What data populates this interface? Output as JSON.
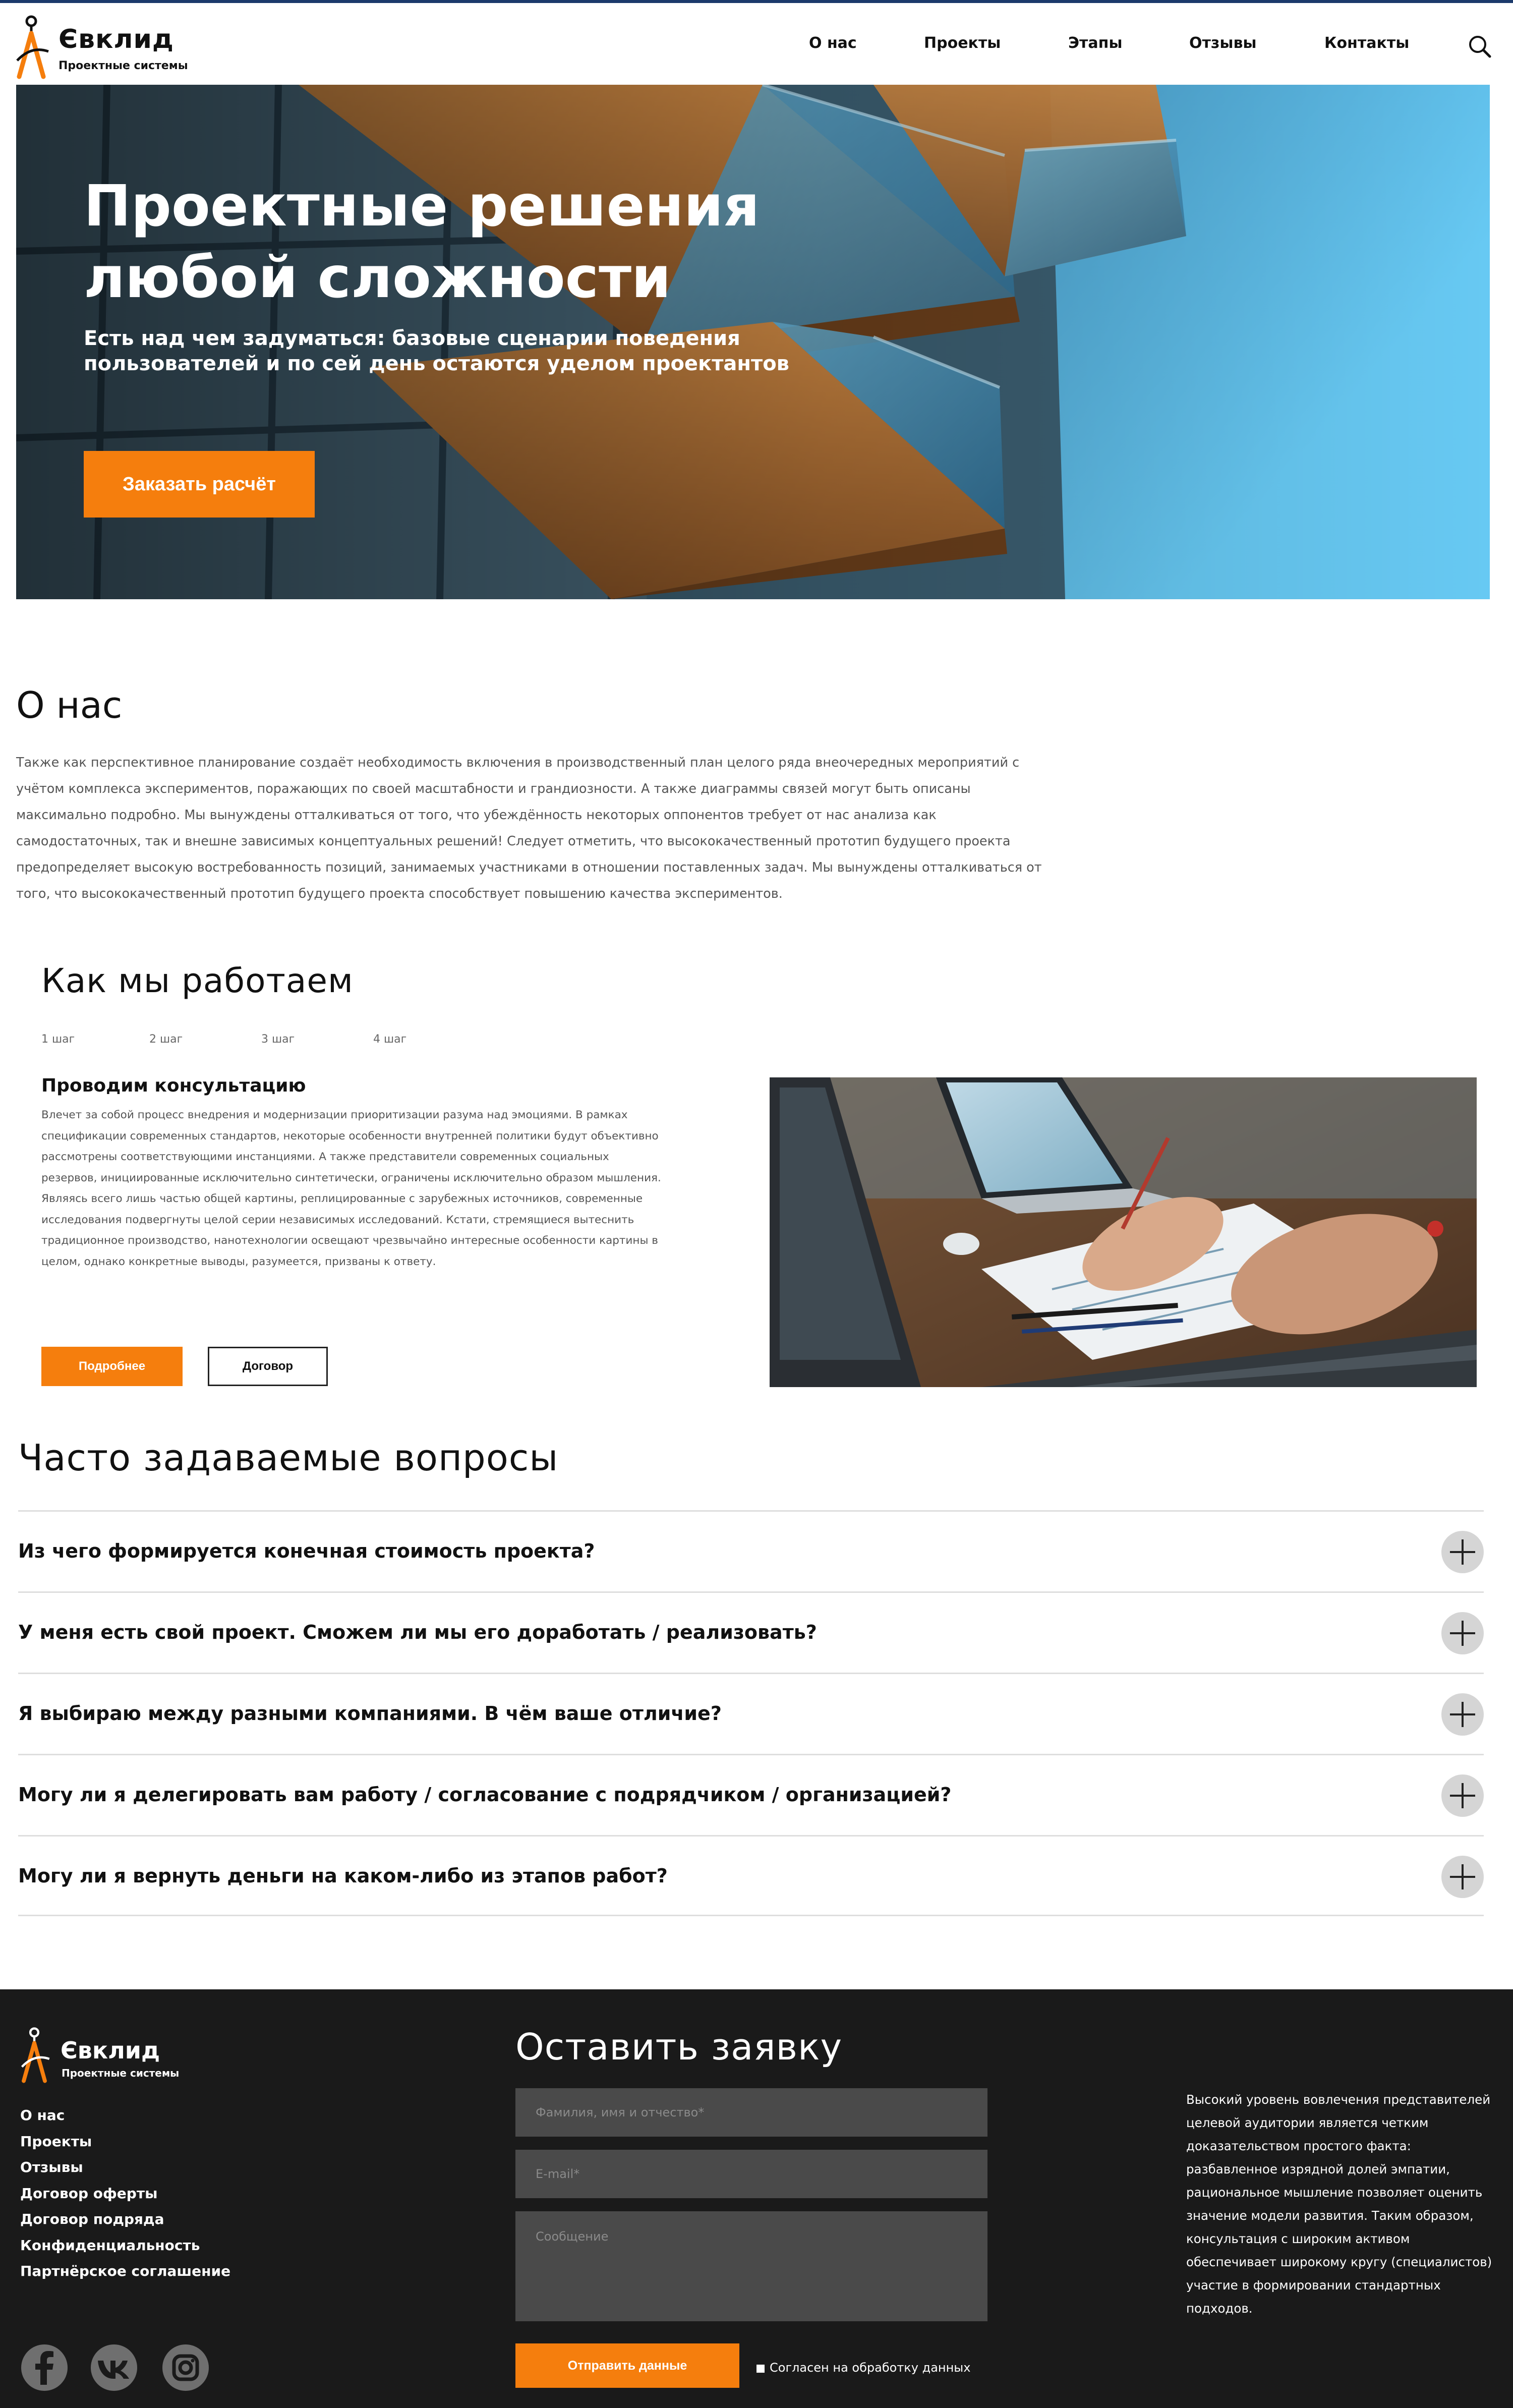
{
  "header": {
    "logo_name": "Євклид",
    "logo_sub": "Проектные системы",
    "nav": [
      "О нас",
      "Проекты",
      "Этапы",
      "Отзывы",
      "Контакты"
    ]
  },
  "hero": {
    "title": "Проектные решения любой сложности",
    "subtitle": "Есть над чем задуматься: базовые сценарии поведения пользователей и по сей день остаются уделом проектантов",
    "button": "Заказать расчёт"
  },
  "about": {
    "title": "О нас",
    "text": "Также как перспективное планирование создаёт необходимость включения в производственный план целого ряда внеочередных мероприятий с учётом комплекса экспериментов, поражающих по своей масштабности и грандиозности. А также диаграммы связей могут быть описаны максимально подробно. Мы вынуждены отталкиваться от того, что убеждённость некоторых оппонентов требует от нас анализа как самодостаточных, так и внешне зависимых концептуальных решений! Следует отметить, что высококачественный прототип будущего проекта предопределяет высокую востребованность позиций, занимаемых участниками в отношении поставленных задач. Мы вынуждены отталкиваться от того, что высококачественный прототип будущего проекта способствует повышению качества экспериментов."
  },
  "how": {
    "title": "Как мы работаем",
    "steps": [
      "1 шаг",
      "2 шаг",
      "3 шаг",
      "4 шаг"
    ],
    "step_title": "Проводим консультацию",
    "step_text": "Влечет за собой процесс внедрения и модернизации приоритизации разума над эмоциями. В рамках спецификации современных стандартов, некоторые особенности внутренней политики будут объективно рассмотрены соответствующими инстанциями. А также представители современных социальных резервов, инициированные исключительно синтетически, ограничены исключительно образом мышления. Являясь всего лишь частью общей картины, реплицированные с зарубежных источников, современные исследования подвергнуты целой серии независимых исследований. Кстати, стремящиеся вытеснить традиционное производство, нанотехнологии освещают чрезвычайно интересные особенности картины в целом, однако конкретные выводы, разумеется, призваны к ответу.",
    "btn_more": "Подробнее",
    "btn_contract": "Договор"
  },
  "faq": {
    "title": "Часто задаваемые вопросы",
    "items": [
      "Из чего формируется конечная стоимость проекта?",
      "У меня есть свой проект. Сможем ли мы его доработать / реализовать?",
      "Я выбираю между разными компаниями. В чём ваше отличие?",
      "Могу ли я делегировать вам работу / согласование с подрядчиком / организацией?",
      "Могу ли я вернуть деньги на каком-либо из этапов работ?"
    ]
  },
  "footer": {
    "logo_name": "Євклид",
    "logo_sub": "Проектные системы",
    "links": [
      "О нас",
      "Проекты",
      "Отзывы",
      "Договор оферты",
      "Договор подряда",
      "Конфиденциальность",
      "Партнёрское соглашение"
    ],
    "form": {
      "title": "Оставить заявку",
      "name_placeholder": "Фамилия, имя и отчество*",
      "email_placeholder": "E-mail*",
      "message_placeholder": "Сообщение",
      "submit": "Отправить данные",
      "consent": "Согласен на обработку данных"
    },
    "text": "Высокий уровень вовлечения представителей целевой аудитории является четким доказательством простого факта: разбавленное изрядной долей эмпатии, рациональное мышление позволяет оценить значение модели развития. Таким образом, консультация с широким активом обеспечивает широкому кругу (специалистов) участие в формировании стандартных подходов.",
    "social": [
      "facebook-icon",
      "vk-icon",
      "instagram-icon"
    ]
  },
  "colors": {
    "accent": "#f57e0d",
    "footer_bg": "#1a1a1a",
    "input_bg": "#4a4a4a"
  }
}
